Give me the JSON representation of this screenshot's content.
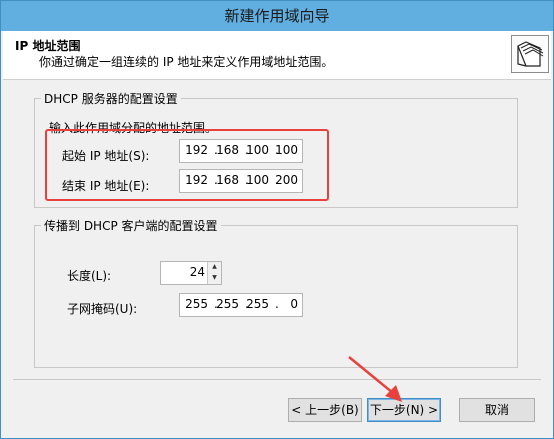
{
  "window": {
    "title": "新建作用域向导"
  },
  "header": {
    "title": "IP 地址范围",
    "description": "你通过确定一组连续的 IP 地址来定义作用域地址范围。",
    "icon": "folder-documents-icon"
  },
  "dhcp_group": {
    "label": "DHCP 服务器的配置设置",
    "instruction": "输入此作用域分配的地址范围。",
    "start_label": "起始 IP 地址(S):",
    "start_ip": [
      "192",
      "168",
      "100",
      "100"
    ],
    "end_label": "结束 IP 地址(E):",
    "end_ip": [
      "192",
      "168",
      "100",
      "200"
    ],
    "highlight_color": "#e8403c"
  },
  "client_group": {
    "label": "传播到 DHCP 客户端的配置设置",
    "length_label": "长度(L):",
    "length_value": "24",
    "mask_label": "子网掩码(U):",
    "mask": [
      "255",
      "255",
      "255",
      "0"
    ]
  },
  "buttons": {
    "back": "< 上一步(B)",
    "next": "下一步(N) >",
    "cancel": "取消"
  },
  "accent": "#61aee0"
}
